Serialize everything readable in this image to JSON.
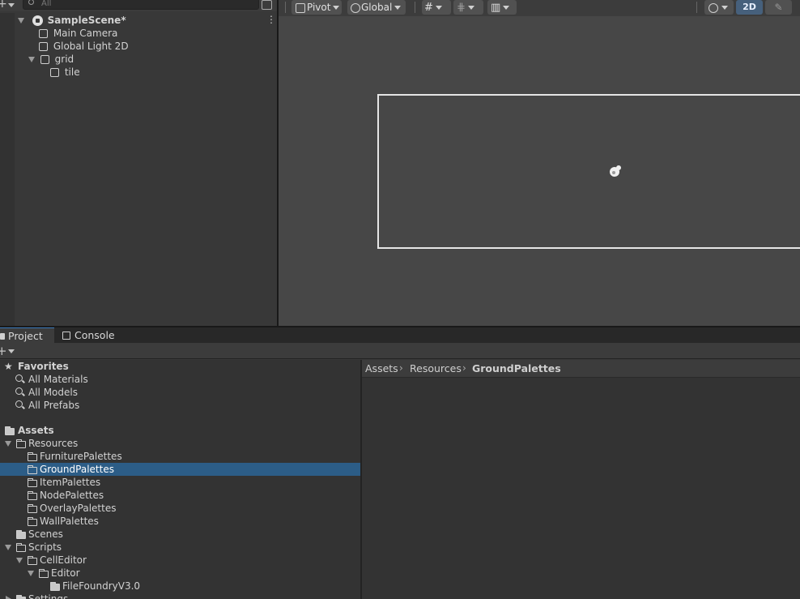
{
  "hierarchy": {
    "search_placeholder": "All",
    "scene_name": "SampleScene*",
    "items": [
      {
        "label": "Main Camera"
      },
      {
        "label": "Global Light 2D"
      },
      {
        "label": "grid"
      },
      {
        "label": "tile"
      }
    ]
  },
  "scene_toolbar": {
    "pivot_label": "Pivot",
    "global_label": "Global",
    "mode_2d_label": "2D"
  },
  "project": {
    "tabs": [
      {
        "label": "Project"
      },
      {
        "label": "Console"
      }
    ],
    "favorites": {
      "label": "Favorites",
      "items": [
        "All Materials",
        "All Models",
        "All Prefabs"
      ]
    },
    "assets_label": "Assets",
    "tree": {
      "resources": "Resources",
      "resource_children": [
        "FurniturePalettes",
        "GroundPalettes",
        "ItemPalettes",
        "NodePalettes",
        "OverlayPalettes",
        "WallPalettes"
      ],
      "scenes": "Scenes",
      "scripts": "Scripts",
      "cell_editor": "CellEditor",
      "editor": "Editor",
      "file_foundry": "FileFoundryV3.0",
      "settings": "Settings"
    },
    "breadcrumb": [
      "Assets",
      "Resources",
      "GroundPalettes"
    ]
  },
  "colors": {
    "selection": "#2c5d87",
    "active_2d": "#46607c",
    "tab_accent": "#3a79bb"
  }
}
